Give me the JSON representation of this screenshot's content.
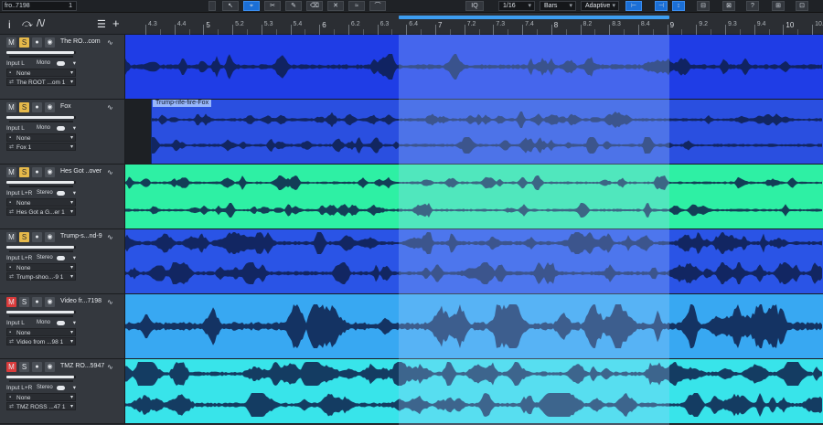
{
  "toolbar": {
    "file_name": "fro..7198",
    "file_num": "1",
    "quantize": "1/16",
    "timebase": "Bars",
    "snap": "Adaptive",
    "quantize_label": "IQ"
  },
  "headbar": {
    "info": "i",
    "tool": "⤼",
    "auto": "/\\/",
    "list": "☰",
    "add": "+"
  },
  "ruler": {
    "labels": [
      "4.3",
      "4.4",
      "5",
      "5.2",
      "5.3",
      "5.4",
      "6",
      "6.2",
      "6.3",
      "6.4",
      "7",
      "7.2",
      "7.3",
      "7.4",
      "8",
      "8.2",
      "8.3",
      "8.4",
      "9",
      "9.2",
      "9.3",
      "9.4",
      "10",
      "10.2",
      "10.3"
    ],
    "major": [
      "5",
      "6",
      "7",
      "8",
      "9",
      "10"
    ]
  },
  "tracks": [
    {
      "name": "The RO...com",
      "mute": false,
      "solo": true,
      "input": "Input L",
      "mode": "Mono",
      "output": "None",
      "channel": "The ROOT ...om 1",
      "color": "#1f3de6"
    },
    {
      "name": "Fox",
      "mute": false,
      "solo": true,
      "input": "Input L",
      "mode": "Mono",
      "output": "None",
      "channel": "Fox 1",
      "color": "#2a4fe0",
      "clip": "Trump-rife-fire-Fox"
    },
    {
      "name": "Hes Got ..over",
      "mute": false,
      "solo": true,
      "input": "Input L+R",
      "mode": "Stereo",
      "output": "None",
      "channel": "Hes Got a G...er 1",
      "color": "#2ef0a4"
    },
    {
      "name": "Trump-s...nd-9",
      "mute": false,
      "solo": true,
      "input": "Input L+R",
      "mode": "Stereo",
      "output": "None",
      "channel": "Trump-shoo...-9 1",
      "color": "#2a54e6"
    },
    {
      "name": "Video fr...7198",
      "mute": true,
      "solo": false,
      "input": "Input L",
      "mode": "Mono",
      "output": "None",
      "channel": "Video from ...98 1",
      "color": "#38a8f2"
    },
    {
      "name": "TMZ RO...5947",
      "mute": true,
      "solo": false,
      "input": "Input L+R",
      "mode": "Stereo",
      "output": "None",
      "channel": "TMZ ROSS ...47 1",
      "color": "#38e4ea"
    }
  ]
}
